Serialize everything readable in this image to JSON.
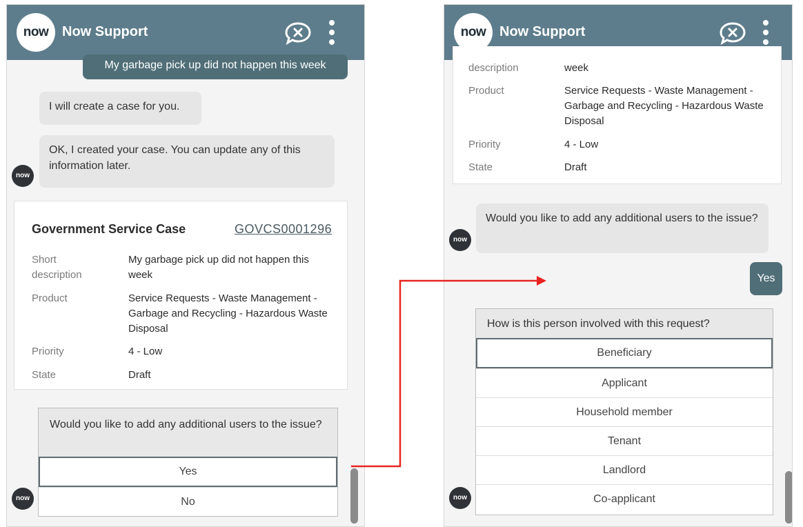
{
  "app": {
    "logo_text": "now",
    "title": "Now Support"
  },
  "colors": {
    "header": "#5e7d8c",
    "user_bubble": "#4f6e78",
    "connector": "#e8231f"
  },
  "icons": {
    "end_chat": "chat-close-icon",
    "menu": "more-vertical-icon"
  },
  "left": {
    "user_message": "My garbage pick up did not happen this week",
    "bot_message_1": "I will create a case for you.",
    "bot_message_2": "OK, I created your case. You can update any of this information later.",
    "case": {
      "title": "Government Service Case",
      "number": "GOVCS0001296",
      "fields": [
        {
          "label": "Short description",
          "value": "My garbage pick up did not happen this week"
        },
        {
          "label": "Product",
          "value": "Service Requests - Waste Management - Garbage and Recycling - Hazardous Waste Disposal"
        },
        {
          "label": "Priority",
          "value": "4 - Low"
        },
        {
          "label": "State",
          "value": "Draft"
        }
      ]
    },
    "question": "Would you like to add any additional users to the issue?",
    "options": [
      "Yes",
      "No"
    ]
  },
  "right": {
    "case_fields": [
      {
        "label": "description",
        "value": "week"
      },
      {
        "label": "Product",
        "value": "Service Requests - Waste Management - Garbage and Recycling - Hazardous Waste Disposal"
      },
      {
        "label": "Priority",
        "value": "4 - Low"
      },
      {
        "label": "State",
        "value": "Draft"
      }
    ],
    "bot_question": "Would you like to add any additional users to the issue?",
    "user_reply": "Yes",
    "question": "How is this person involved with this request?",
    "options": [
      "Beneficiary",
      "Applicant",
      "Household member",
      "Tenant",
      "Landlord",
      "Co-applicant"
    ]
  }
}
